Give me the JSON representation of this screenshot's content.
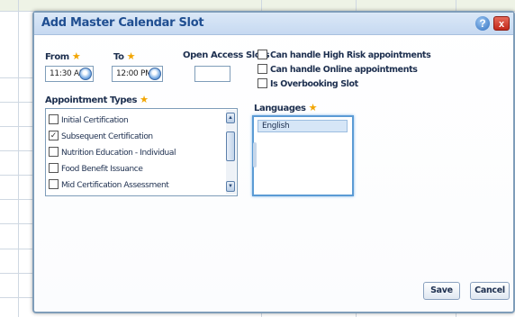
{
  "dialog": {
    "title": "Add Master Calendar Slot",
    "help_icon": "?",
    "close_icon": "x"
  },
  "from": {
    "label": "From",
    "value": "11:30 AM"
  },
  "to": {
    "label": "To",
    "value": "12:00 PM"
  },
  "open_access": {
    "label": "Open Access Slots",
    "value": ""
  },
  "options": [
    {
      "label": "Can handle High Risk appointments",
      "checked": false
    },
    {
      "label": "Can handle Online appointments",
      "checked": false
    },
    {
      "label": "Is Overbooking Slot",
      "checked": false
    }
  ],
  "appointment_types": {
    "label": "Appointment Types",
    "items": [
      {
        "label": "Initial Certification",
        "checked": false
      },
      {
        "label": "Subsequent Certification",
        "checked": true
      },
      {
        "label": "Nutrition Education - Individual",
        "checked": false
      },
      {
        "label": "Food Benefit Issuance",
        "checked": false
      },
      {
        "label": "Mid Certification Assessment",
        "checked": false
      }
    ]
  },
  "languages": {
    "label": "Languages",
    "items": [
      "English"
    ]
  },
  "buttons": {
    "save": "Save",
    "cancel": "Cancel"
  },
  "colors": {
    "title": "#1f4e91",
    "required_star": "#f2a500",
    "close": "#c2281b"
  },
  "icons": {
    "help": "help-icon",
    "close": "close-icon",
    "clock": "clock-icon",
    "star": "required-star-icon"
  }
}
